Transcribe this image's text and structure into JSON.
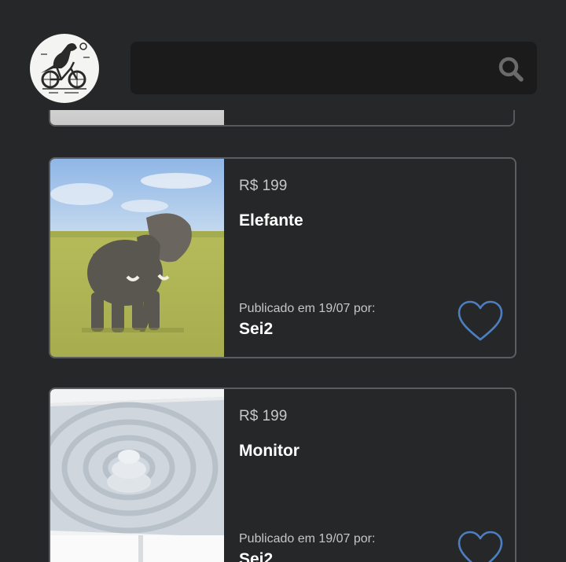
{
  "search": {
    "value": "",
    "placeholder": ""
  },
  "icons": {
    "search": "search-icon",
    "favorite": "heart-outline-icon",
    "logo": "dinosaur-bicycle-logo"
  },
  "colors": {
    "background": "#262728",
    "search_bg": "#1b1b1c",
    "card_border": "#5b5d60",
    "heart_accent": "#4d7fc0",
    "muted_text": "#c6c6c6"
  },
  "listings": [
    {
      "price": "R$ 199",
      "title": "Elefante",
      "published_label": "Publicado em 19/07 por:",
      "seller": "Sei2",
      "image": "elephant-photo"
    },
    {
      "price": "R$ 199",
      "title": "Monitor",
      "published_label": "Publicado em 19/07 por:",
      "seller": "Sei2",
      "image": "monitor-photo"
    }
  ]
}
